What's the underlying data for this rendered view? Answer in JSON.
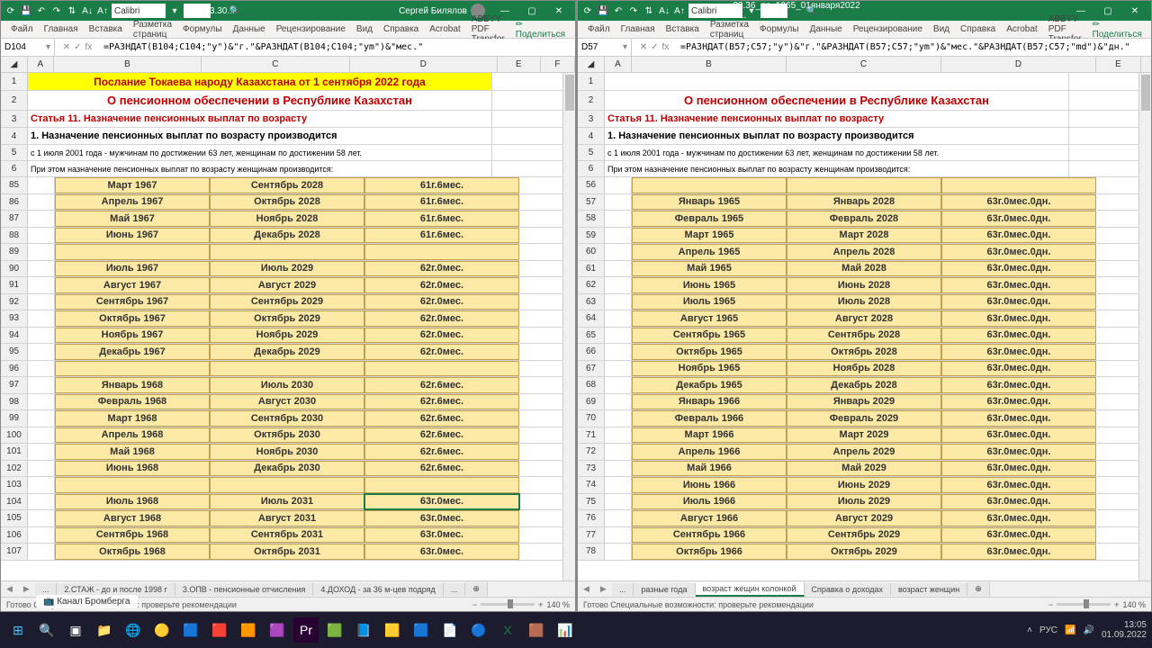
{
  "left": {
    "title_user": "Сергей Билялов",
    "filename": "23.30...",
    "font": "Calibri",
    "namebox": "D104",
    "formula": "=РАЗНДАТ(B104;C104;\"y\")&\"г.\"&РАЗНДАТ(B104;C104;\"ym\")&\"мес.\"",
    "tabs": [
      "Файл",
      "Главная",
      "Вставка",
      "Разметка страниц",
      "Формулы",
      "Данные",
      "Рецензирование",
      "Вид",
      "Справка",
      "Acrobat",
      "ABBYY PDF Transfor"
    ],
    "share": "Поделиться",
    "cols": [
      "A",
      "B",
      "C",
      "D",
      "E",
      "F"
    ],
    "header_rows": {
      "r1": "Послание Токаева народу Казахстана от 1 сентября 2022 года",
      "r2": "О пенсионном обеспечении в Республике Казахстан",
      "r3": "Статья 11. Назначение пенсионных выплат по возрасту",
      "r4": "1. Назначение пенсионных выплат по возрасту производится",
      "r5": "с 1 июля 2001 года - мужчинам по достижении 63 лет, женщинам по достижении 58 лет.",
      "r6": "При этом назначение пенсионных выплат по возрасту женщинам производится:"
    },
    "chart_data": {
      "type": "table",
      "columns": [
        "row",
        "B",
        "C",
        "D"
      ],
      "rows": [
        [
          85,
          "Март 1967",
          "Сентябрь 2028",
          "61г.6мес."
        ],
        [
          86,
          "Апрель 1967",
          "Октябрь 2028",
          "61г.6мес."
        ],
        [
          87,
          "Май 1967",
          "Ноябрь 2028",
          "61г.6мес."
        ],
        [
          88,
          "Июнь 1967",
          "Декабрь 2028",
          "61г.6мес."
        ],
        [
          89,
          "",
          "",
          ""
        ],
        [
          90,
          "Июль 1967",
          "Июль 2029",
          "62г.0мес."
        ],
        [
          91,
          "Август 1967",
          "Август 2029",
          "62г.0мес."
        ],
        [
          92,
          "Сентябрь 1967",
          "Сентябрь 2029",
          "62г.0мес."
        ],
        [
          93,
          "Октябрь 1967",
          "Октябрь 2029",
          "62г.0мес."
        ],
        [
          94,
          "Ноябрь 1967",
          "Ноябрь 2029",
          "62г.0мес."
        ],
        [
          95,
          "Декабрь 1967",
          "Декабрь 2029",
          "62г.0мес."
        ],
        [
          96,
          "",
          "",
          ""
        ],
        [
          97,
          "Январь 1968",
          "Июль 2030",
          "62г.6мес."
        ],
        [
          98,
          "Февраль 1968",
          "Август 2030",
          "62г.6мес."
        ],
        [
          99,
          "Март 1968",
          "Сентябрь 2030",
          "62г.6мес."
        ],
        [
          100,
          "Апрель 1968",
          "Октябрь 2030",
          "62г.6мес."
        ],
        [
          101,
          "Май 1968",
          "Ноябрь 2030",
          "62г.6мес."
        ],
        [
          102,
          "Июнь 1968",
          "Декабрь 2030",
          "62г.6мес."
        ],
        [
          103,
          "",
          "",
          ""
        ],
        [
          104,
          "Июль 1968",
          "Июль 2031",
          "63г.0мес."
        ],
        [
          105,
          "Август 1968",
          "Август 2031",
          "63г.0мес."
        ],
        [
          106,
          "Сентябрь 1968",
          "Сентябрь 2031",
          "63г.0мес."
        ],
        [
          107,
          "Октябрь 1968",
          "Октябрь 2031",
          "63г.0мес."
        ]
      ]
    },
    "sheets": [
      "...",
      "2.СТАЖ - до и после 1998 г",
      "3.ОПВ - пенсионные отчисления",
      "4.ДОХОД - за 36 м-цев подряд",
      "..."
    ],
    "status": "Готово   Специальные возможности: проверьте рекомендации",
    "zoom": "140 %"
  },
  "right": {
    "filename": "22.36_до_1965_01января2022 Б...",
    "font": "Calibri",
    "namebox": "D57",
    "formula": "=РАЗНДАТ(B57;C57;\"y\")&\"г.\"&РАЗНДАТ(B57;C57;\"ym\")&\"мес.\"&РАЗНДАТ(B57;C57;\"md\")&\"дн.\"",
    "tabs": [
      "Файл",
      "Главная",
      "Вставка",
      "Разметка страниц",
      "Формулы",
      "Данные",
      "Рецензирование",
      "Вид",
      "Справка",
      "Acrobat",
      "ABBYY PDF Transfor"
    ],
    "share": "Поделиться",
    "cols": [
      "A",
      "B",
      "C",
      "D",
      "E"
    ],
    "header_rows": {
      "r2": "О пенсионном обеспечении в Республике Казахстан",
      "r3": "Статья 11. Назначение пенсионных выплат по возрасту",
      "r4": "1. Назначение пенсионных выплат по возрасту производится",
      "r5": "с 1 июля 2001 года - мужчинам по достижении 63 лет, женщинам по достижении 58 лет.",
      "r6": "При этом назначение пенсионных выплат по возрасту женщинам производится:"
    },
    "chart_data": {
      "type": "table",
      "columns": [
        "row",
        "B",
        "C",
        "D"
      ],
      "rows": [
        [
          56,
          "",
          "",
          ""
        ],
        [
          57,
          "Январь 1965",
          "Январь 2028",
          "63г.0мес.0дн."
        ],
        [
          58,
          "Февраль 1965",
          "Февраль 2028",
          "63г.0мес.0дн."
        ],
        [
          59,
          "Март 1965",
          "Март 2028",
          "63г.0мес.0дн."
        ],
        [
          60,
          "Апрель 1965",
          "Апрель 2028",
          "63г.0мес.0дн."
        ],
        [
          61,
          "Май 1965",
          "Май 2028",
          "63г.0мес.0дн."
        ],
        [
          62,
          "Июнь 1965",
          "Июнь 2028",
          "63г.0мес.0дн."
        ],
        [
          63,
          "Июль 1965",
          "Июль 2028",
          "63г.0мес.0дн."
        ],
        [
          64,
          "Август 1965",
          "Август 2028",
          "63г.0мес.0дн."
        ],
        [
          65,
          "Сентябрь 1965",
          "Сентябрь 2028",
          "63г.0мес.0дн."
        ],
        [
          66,
          "Октябрь 1965",
          "Октябрь 2028",
          "63г.0мес.0дн."
        ],
        [
          67,
          "Ноябрь 1965",
          "Ноябрь 2028",
          "63г.0мес.0дн."
        ],
        [
          68,
          "Декабрь 1965",
          "Декабрь 2028",
          "63г.0мес.0дн."
        ],
        [
          69,
          "Январь 1966",
          "Январь 2029",
          "63г.0мес.0дн."
        ],
        [
          70,
          "Февраль 1966",
          "Февраль 2029",
          "63г.0мес.0дн."
        ],
        [
          71,
          "Март 1966",
          "Март 2029",
          "63г.0мес.0дн."
        ],
        [
          72,
          "Апрель 1966",
          "Апрель 2029",
          "63г.0мес.0дн."
        ],
        [
          73,
          "Май 1966",
          "Май 2029",
          "63г.0мес.0дн."
        ],
        [
          74,
          "Июнь 1966",
          "Июнь 2029",
          "63г.0мес.0дн."
        ],
        [
          75,
          "Июль 1966",
          "Июль 2029",
          "63г.0мес.0дн."
        ],
        [
          76,
          "Август 1966",
          "Август 2029",
          "63г.0мес.0дн."
        ],
        [
          77,
          "Сентябрь 1966",
          "Сентябрь 2029",
          "63г.0мес.0дн."
        ],
        [
          78,
          "Октябрь 1966",
          "Октябрь 2029",
          "63г.0мес.0дн."
        ]
      ]
    },
    "sheets": [
      "...",
      "разные года",
      "возраст жещин колонкой",
      "Справка о доходах",
      "возраст женщин"
    ],
    "active_sheet": 2,
    "status": "Готово   Специальные возможности: проверьте рекомендации",
    "zoom": "140 %"
  },
  "taskbar": {
    "lang": "РУС",
    "time": "13:05",
    "date": "01.09.2022"
  },
  "channel": "Канал Бромберга"
}
